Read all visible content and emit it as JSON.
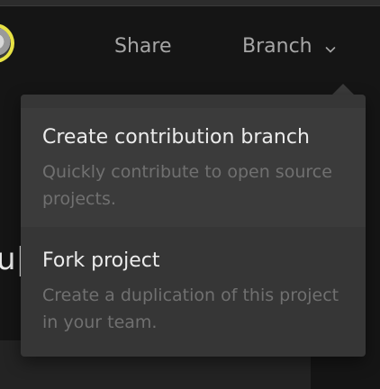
{
  "header": {
    "share_label": "Share",
    "branch_label": "Branch"
  },
  "background": {
    "partial_text": "u|"
  },
  "branch_menu": {
    "items": [
      {
        "title": "Create contribution branch",
        "description": "Quickly contribute to open source projects."
      },
      {
        "title": "Fork project",
        "description": "Create a duplication of this project in your team."
      }
    ]
  }
}
